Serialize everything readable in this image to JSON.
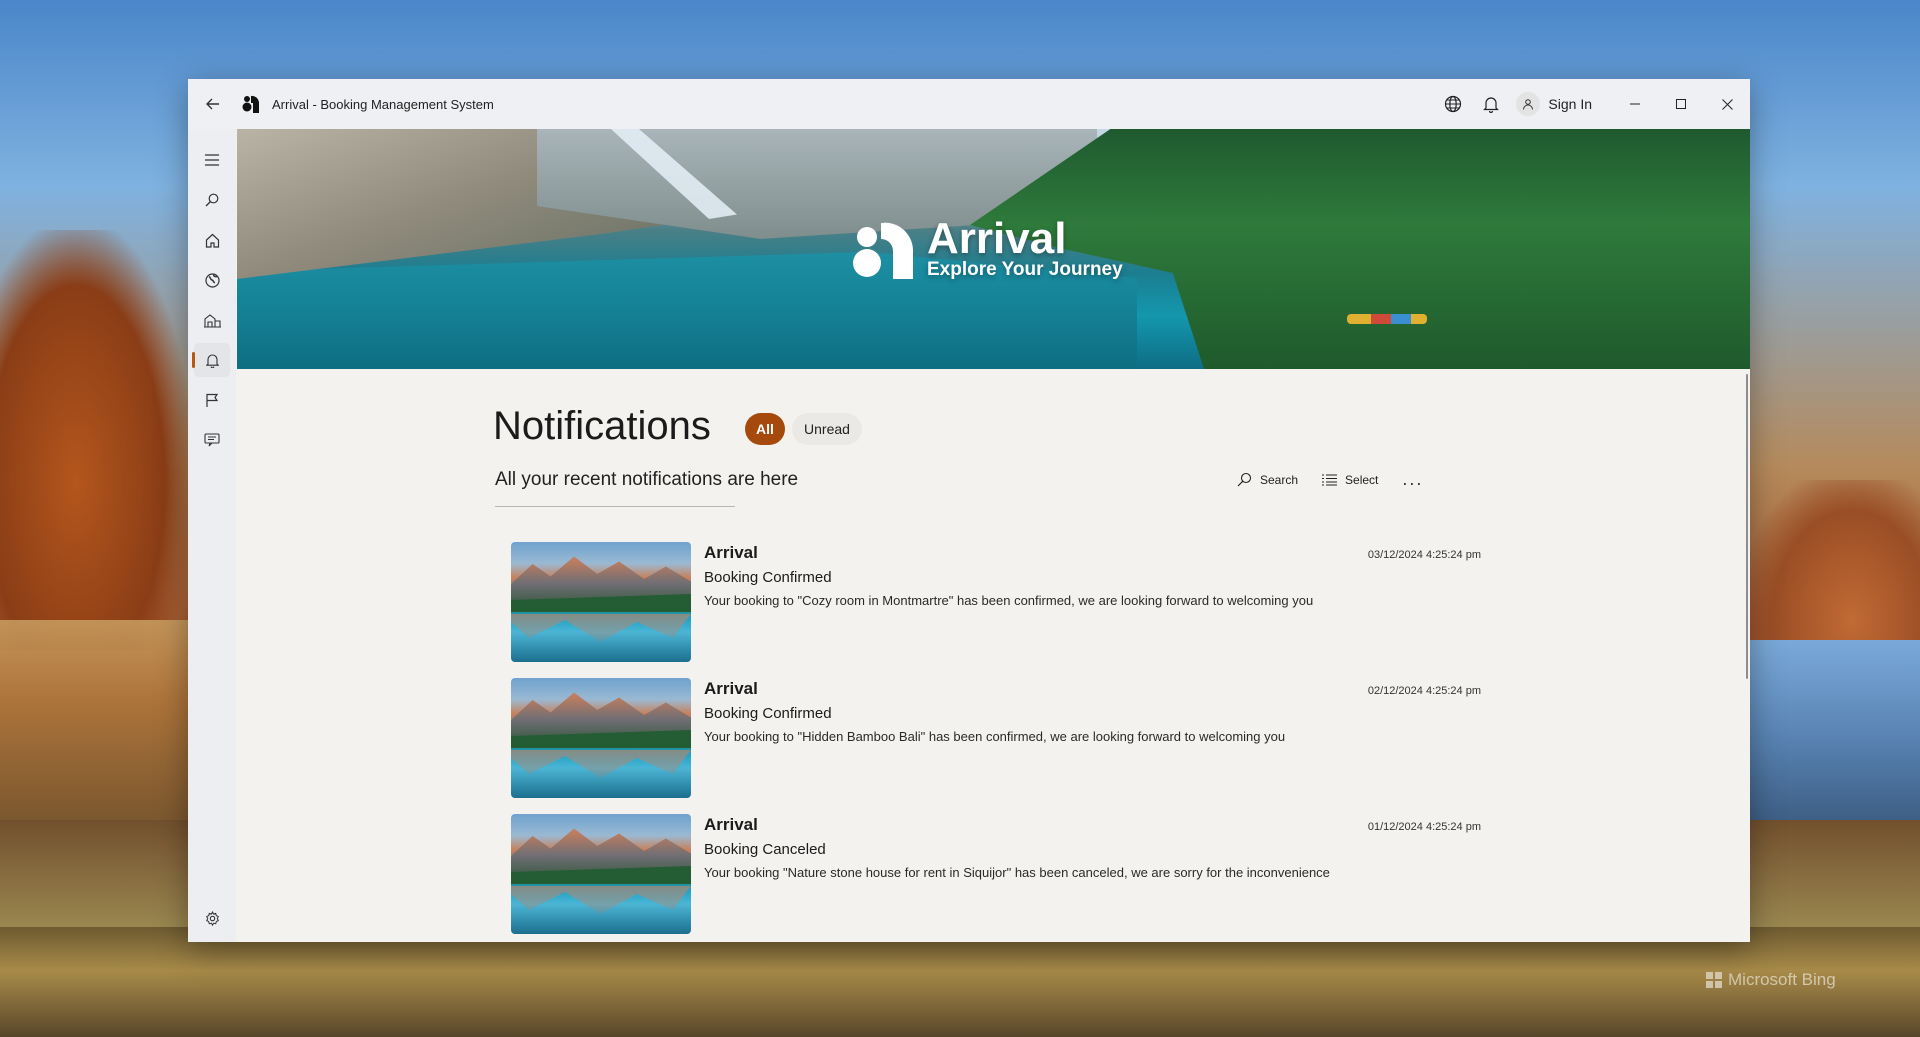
{
  "window": {
    "title": "Arrival - Booking Management System",
    "sign_in_label": "Sign In"
  },
  "hero": {
    "brand_name": "Arrival",
    "tagline": "Explore Your Journey"
  },
  "page": {
    "title": "Notifications",
    "subtitle": "All your recent notifications are here",
    "filters": [
      {
        "label": "All",
        "selected": true
      },
      {
        "label": "Unread",
        "selected": false
      }
    ],
    "actions": {
      "search_label": "Search",
      "select_label": "Select",
      "more_label": "..."
    }
  },
  "notifications": [
    {
      "app": "Arrival",
      "title": "Booking Confirmed",
      "body": "Your booking to \"Cozy room in Montmartre\" has been confirmed, we are looking forward to welcoming you",
      "time": "03/12/2024 4:25:24 pm"
    },
    {
      "app": "Arrival",
      "title": "Booking Confirmed",
      "body": "Your booking to \"Hidden Bamboo Bali\" has been confirmed, we are looking forward to welcoming you",
      "time": "02/12/2024 4:25:24 pm"
    },
    {
      "app": "Arrival",
      "title": "Booking Canceled",
      "body": "Your booking \"Nature stone house for rent in Siquijor\" has been canceled, we are sorry for the inconvenience",
      "time": "01/12/2024 4:25:24 pm"
    }
  ],
  "sidebar": {
    "items": [
      {
        "icon": "hamburger-menu-icon"
      },
      {
        "icon": "search-icon"
      },
      {
        "icon": "home-icon"
      },
      {
        "icon": "globe-icon"
      },
      {
        "icon": "hotel-icon"
      },
      {
        "icon": "bell-icon",
        "active": true
      },
      {
        "icon": "flag-icon"
      },
      {
        "icon": "chat-icon"
      },
      {
        "icon": "settings-icon"
      }
    ]
  },
  "desktop": {
    "watermark": "Microsoft Bing"
  },
  "colors": {
    "accent": "#a5490d",
    "indicator": "#b8570e"
  }
}
